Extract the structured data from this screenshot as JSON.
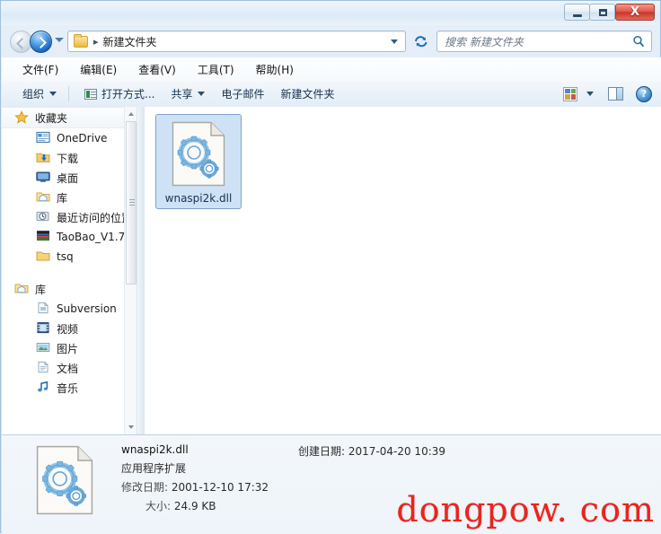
{
  "window": {
    "controls": {
      "minimize": "minimize-button",
      "maximize": "maximize-button",
      "close_label": "X"
    }
  },
  "nav": {
    "back_title": "back",
    "forward_title": "forward",
    "history_title": "recent-pages",
    "breadcrumb": "新建文件夹",
    "breadcrumb_separator": "▸",
    "refresh_title": "refresh"
  },
  "search": {
    "placeholder": "搜索 新建文件夹"
  },
  "menubar": {
    "items": [
      {
        "label": "文件(F)"
      },
      {
        "label": "编辑(E)"
      },
      {
        "label": "查看(V)"
      },
      {
        "label": "工具(T)"
      },
      {
        "label": "帮助(H)"
      }
    ]
  },
  "toolbar": {
    "organize": "组织",
    "open_with": "打开方式...",
    "share": "共享",
    "email": "电子邮件",
    "new_folder": "新建文件夹",
    "help_label": "?"
  },
  "sidebar": {
    "favorites": {
      "label": "收藏夹",
      "items": [
        {
          "label": "OneDrive",
          "icon": "onedrive-icon"
        },
        {
          "label": "下载",
          "icon": "downloads-icon"
        },
        {
          "label": "桌面",
          "icon": "desktop-icon"
        },
        {
          "label": "库",
          "icon": "library-icon"
        },
        {
          "label": "最近访问的位置",
          "icon": "recent-places-icon"
        },
        {
          "label": "TaoBao_V1.7",
          "icon": "taobao-icon"
        },
        {
          "label": "tsq",
          "icon": "folder-icon"
        }
      ]
    },
    "libraries": {
      "label": "库",
      "items": [
        {
          "label": "Subversion",
          "icon": "document-icon"
        },
        {
          "label": "视频",
          "icon": "video-icon"
        },
        {
          "label": "图片",
          "icon": "pictures-icon"
        },
        {
          "label": "文档",
          "icon": "documents-icon"
        },
        {
          "label": "音乐",
          "icon": "music-icon"
        }
      ]
    }
  },
  "files": [
    {
      "name": "wnaspi2k.dll",
      "icon": "dll-file-icon",
      "selected": true
    }
  ],
  "details": {
    "name": "wnaspi2k.dll",
    "type": "应用程序扩展",
    "modified_label": "修改日期:",
    "modified_value": "2001-12-10 17:32",
    "size_label": "大小:",
    "size_value": "24.9 KB",
    "created_label": "创建日期:",
    "created_value": "2017-04-20 10:39"
  },
  "watermark": "dongpow. com",
  "colors": {
    "accent_blue": "#1661ba",
    "selection_fill": "#cfe2f5",
    "selection_border": "#7da2c8",
    "close_red": "#c8362a",
    "watermark_red": "#e8251e"
  }
}
